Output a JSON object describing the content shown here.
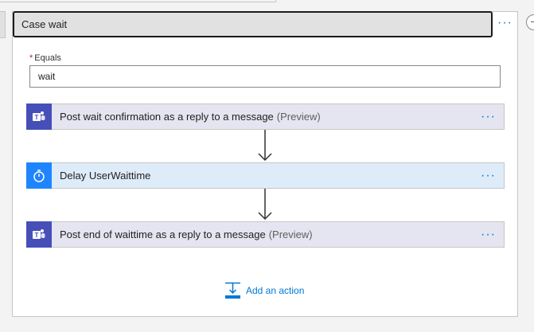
{
  "case": {
    "title": "Case wait",
    "menu_label": "···"
  },
  "condition": {
    "required_mark": "*",
    "label": "Equals",
    "value": "wait"
  },
  "actions": [
    {
      "title": "Post wait confirmation as a reply to a message",
      "preview": "(Preview)",
      "icon": "teams-icon",
      "menu_label": "···"
    },
    {
      "title": "Delay UserWaittime",
      "preview": "",
      "icon": "timer-icon",
      "menu_label": "···"
    },
    {
      "title": "Post end of waittime as a reply to a message",
      "preview": "(Preview)",
      "icon": "teams-icon",
      "menu_label": "···"
    }
  ],
  "add_action": {
    "label": "Add an action",
    "icon": "add-action-icon"
  },
  "colors": {
    "accent": "#0078d4",
    "teams": "#464eb8",
    "teams_bg": "#e5e5f1",
    "delay": "#1f85ff",
    "delay_bg": "#deecf9"
  }
}
